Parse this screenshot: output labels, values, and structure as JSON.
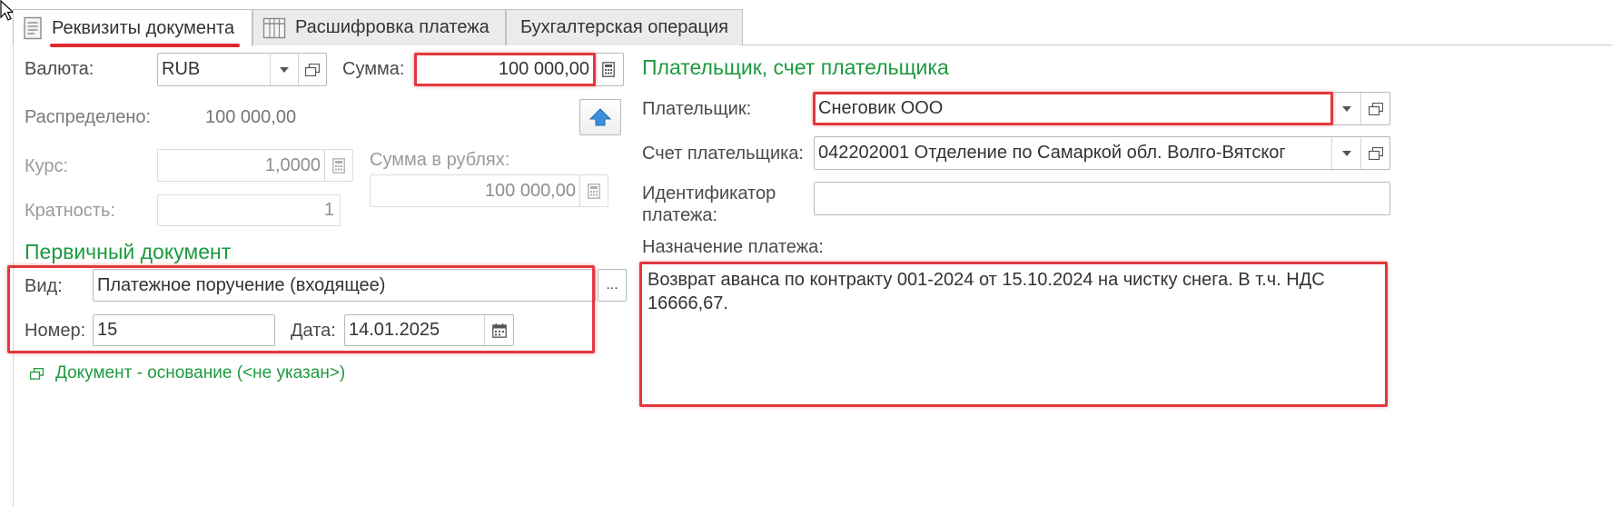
{
  "tabs": [
    {
      "label": "Реквизиты документа",
      "icon": "document-icon",
      "active": true
    },
    {
      "label": "Расшифровка платежа",
      "icon": "table-icon",
      "active": false
    },
    {
      "label": "Бухгалтерская операция",
      "icon": "",
      "active": false
    }
  ],
  "currency": {
    "label": "Валюта:",
    "value": "RUB"
  },
  "amount": {
    "label": "Сумма:",
    "value": "100 000,00"
  },
  "distributed": {
    "label": "Распределено:",
    "value": "100 000,00"
  },
  "rate": {
    "label": "Курс:",
    "value": "1,0000"
  },
  "rub_amount": {
    "label": "Сумма в рублях:",
    "value": "100 000,00"
  },
  "multiplicity": {
    "label": "Кратность:",
    "value": "1"
  },
  "primary_doc": {
    "title": "Первичный документ",
    "kind_label": "Вид:",
    "kind_value": "Платежное поручение (входящее)",
    "kind_button": "...",
    "number_label": "Номер:",
    "number_value": "15",
    "date_label": "Дата:",
    "date_value": "14.01.2025"
  },
  "basis_link": "Документ - основание (<не указан>)",
  "payer_section": {
    "title": "Плательщик, счет плательщика",
    "payer_label": "Плательщик:",
    "payer_value": "Снеговик ООО",
    "account_label": "Счет плательщика:",
    "account_value": "042202001 Отделение по Самаркой обл. Волго-Вятског",
    "identifier_label_1": "Идентификатор",
    "identifier_label_2": "платежа:",
    "identifier_value": ""
  },
  "purpose": {
    "label": "Назначение платежа:",
    "value": "Возврат аванса по контракту 001-2024 от 15.10.2024 на чистку снега. В т.ч. НДС 16666,67."
  },
  "colors": {
    "accent_green": "#1d9a3f",
    "highlight_red": "#e0393e",
    "tab_underline_red": "#e2262d"
  }
}
